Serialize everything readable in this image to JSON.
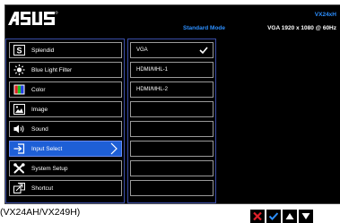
{
  "header": {
    "brand": "ASUS",
    "model": "VX24xH",
    "mode": "Standard Mode",
    "resolution": "VGA 1920 x 1080 @ 60Hz"
  },
  "menu": {
    "items": [
      {
        "label": "Splendid",
        "icon": "splendid-s-icon"
      },
      {
        "label": "Blue Light Filter",
        "icon": "sun-icon"
      },
      {
        "label": "Color",
        "icon": "color-bars-icon"
      },
      {
        "label": "Image",
        "icon": "image-icon"
      },
      {
        "label": "Sound",
        "icon": "speaker-icon"
      },
      {
        "label": "Input Select",
        "icon": "input-arrow-icon"
      },
      {
        "label": "System Setup",
        "icon": "wrench-icon"
      },
      {
        "label": "Shortcut",
        "icon": "shortcut-icon"
      }
    ],
    "active_index": 5
  },
  "submenu": {
    "options": [
      {
        "label": "VGA",
        "selected": true
      },
      {
        "label": "HDMI/MHL-1",
        "selected": false
      },
      {
        "label": "HDMI/MHL-2",
        "selected": false
      }
    ],
    "empty_rows": 5
  },
  "caption": "(VX24AH/VX249H)",
  "buttons": [
    {
      "icon": "close-x-icon",
      "color": "#e0202a"
    },
    {
      "icon": "check-icon",
      "color": "#2c8fff"
    },
    {
      "icon": "up-arrow-icon",
      "color": "#ffffff"
    },
    {
      "icon": "down-arrow-icon",
      "color": "#ffffff"
    }
  ],
  "colors": {
    "accent": "#2c8fff",
    "active_bg": "#1e5fd6",
    "border": "#3a4da8"
  }
}
